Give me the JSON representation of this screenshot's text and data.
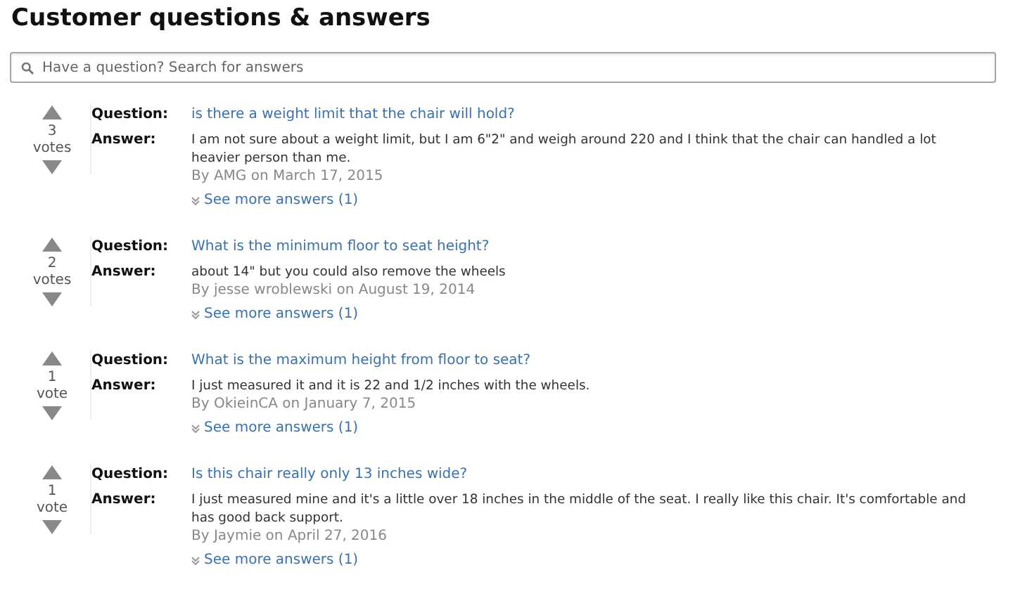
{
  "title": "Customer questions & answers",
  "search": {
    "placeholder": "Have a question? Search for answers"
  },
  "items": [
    {
      "question_label": "Question:",
      "answer_label": "Answer:",
      "votes": "3",
      "votes_label": "votes",
      "question": "is there a weight limit that the chair will hold?",
      "answer": "I am not sure about a weight limit, but I am 6\"2\" and weigh around 220 and I think that the chair can handled a lot heavier person than me.",
      "byline": "By AMG on March 17, 2015",
      "more": "See more answers (1)"
    },
    {
      "question_label": "Question:",
      "answer_label": "Answer:",
      "votes": "2",
      "votes_label": "votes",
      "question": "What is the minimum floor to seat height?",
      "answer": "about 14\" but you could also remove the wheels",
      "byline": "By jesse wroblewski on August 19, 2014",
      "more": "See more answers (1)"
    },
    {
      "question_label": "Question:",
      "answer_label": "Answer:",
      "votes": "1",
      "votes_label": "vote",
      "question": "What is the maximum height from floor to seat?",
      "answer": "I just measured it and it is 22 and 1/2 inches with the wheels.",
      "byline": "By OkieinCA on January 7, 2015",
      "more": "See more answers (1)"
    },
    {
      "question_label": "Question:",
      "answer_label": "Answer:",
      "votes": "1",
      "votes_label": "vote",
      "question": "Is this chair really only 13 inches wide?",
      "answer": "I just measured mine and it's a little over 18 inches in the middle of the seat. I really like this chair. It's comfortable and has good back support.",
      "byline": "By Jaymie on April 27, 2016",
      "more": "See more answers (1)"
    }
  ]
}
